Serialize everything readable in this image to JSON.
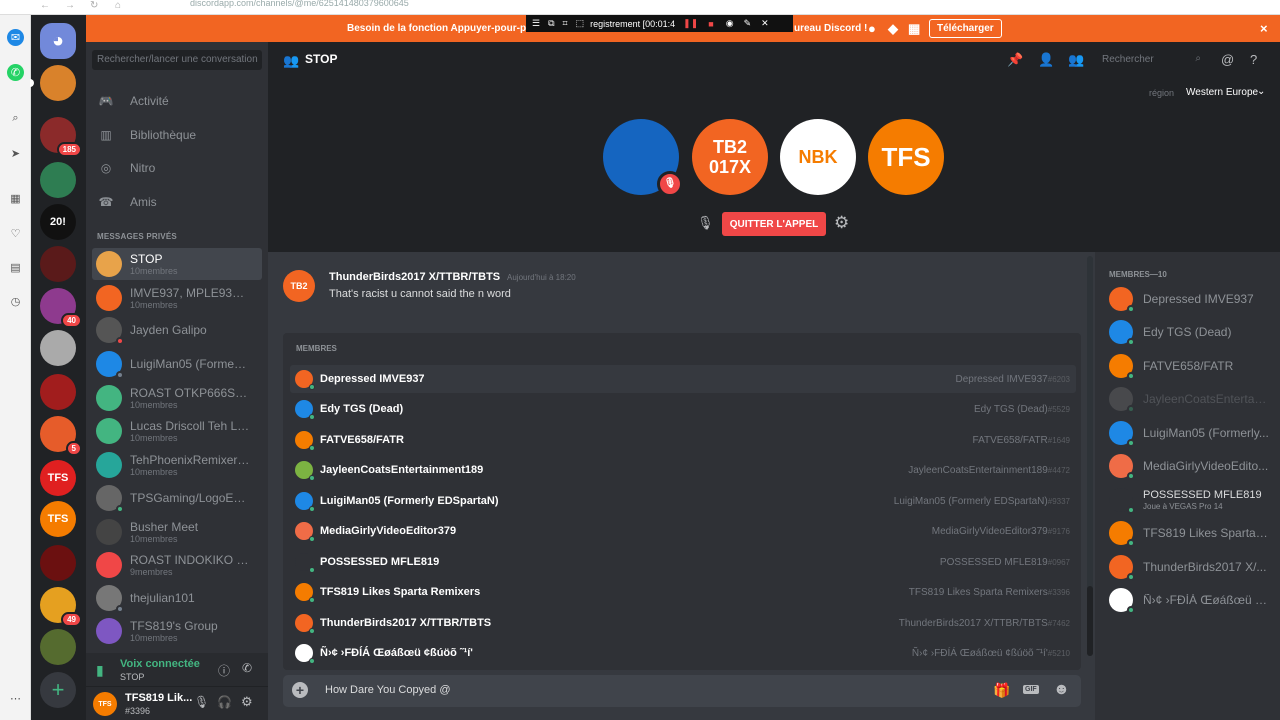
{
  "browser": {
    "url": "discordapp.com/channels/@me/625141480379600645"
  },
  "banner": {
    "text_left": "Besoin de la fonction Appuyer-pour-par",
    "text_right": "ureau Discord !",
    "download": "Télécharger",
    "close": "×"
  },
  "recorder": {
    "label": "registrement [00:01:4"
  },
  "dm_search": {
    "placeholder": "Rechercher/lancer une conversation"
  },
  "nav": [
    {
      "label": "Activité",
      "icon": "gamepad-icon"
    },
    {
      "label": "Bibliothèque",
      "icon": "library-icon"
    },
    {
      "label": "Nitro",
      "icon": "nitro-icon"
    },
    {
      "label": "Amis",
      "icon": "friends-icon"
    }
  ],
  "dm_header": "MESSAGES PRIVÉS",
  "dms": [
    {
      "name": "STOP",
      "sub": "10membres",
      "color": "#e8a34a",
      "sel": true
    },
    {
      "name": "IMVE937, MPLE935, ...",
      "sub": "10membres",
      "color": "#f26522"
    },
    {
      "name": "Jayden Galipo",
      "sub": "",
      "color": "#555"
    },
    {
      "name": "LuigiMan05 (Formerl...",
      "sub": "",
      "color": "#1e88e5"
    },
    {
      "name": "ROAST OTKP666SC ...",
      "sub": "10membres",
      "color": "#43b581"
    },
    {
      "name": "Lucas Driscoll Teh Lu...",
      "sub": "10membres",
      "color": "#43b581"
    },
    {
      "name": "TehPhoenixRemixer9...",
      "sub": "10membres",
      "color": "#26a69a"
    },
    {
      "name": "TPSGaming/LogoEdi...",
      "sub": "",
      "color": "#666"
    },
    {
      "name": "Busher Meet",
      "sub": "10membres",
      "color": "#444"
    },
    {
      "name": "ROAST INDOKIKO F...",
      "sub": "9membres",
      "color": "#f04747"
    },
    {
      "name": "thejulian101",
      "sub": "",
      "color": "#777"
    },
    {
      "name": "TFS819's Group",
      "sub": "10membres",
      "color": "#7e57c2"
    }
  ],
  "voice": {
    "title": "Voix connectée",
    "channel": "STOP"
  },
  "user": {
    "name": "TFS819 Lik...",
    "tag": "#3396",
    "avatar_text": "TFS"
  },
  "guilds": [
    {
      "text": "",
      "color": "#7289da",
      "badge": ""
    },
    {
      "text": "",
      "color": "#d9822b",
      "badge": ""
    },
    {
      "text": "",
      "color": "#8b2a2a",
      "badge": "185"
    },
    {
      "text": "",
      "color": "#2e7d52",
      "badge": ""
    },
    {
      "text": "20!",
      "color": "#111",
      "badge": ""
    },
    {
      "text": "",
      "color": "#5a1a1a",
      "badge": ""
    },
    {
      "text": "",
      "color": "#8e3a8e",
      "badge": "40"
    },
    {
      "text": "",
      "color": "#aaa",
      "badge": ""
    },
    {
      "text": "",
      "color": "#a11d1d",
      "badge": ""
    },
    {
      "text": "",
      "color": "#e65c2a",
      "badge": "5"
    },
    {
      "text": "TFS",
      "color": "#e02020",
      "badge": ""
    },
    {
      "text": "TFS",
      "color": "#f57c00",
      "badge": ""
    },
    {
      "text": "",
      "color": "#6b1010",
      "badge": ""
    },
    {
      "text": "",
      "color": "#e5a020",
      "badge": "49"
    },
    {
      "text": "",
      "color": "#556b2f",
      "badge": ""
    }
  ],
  "channel": {
    "title": "STOP",
    "search_placeholder": "Rechercher"
  },
  "region": {
    "label": "région",
    "value": "Western Europe"
  },
  "call": {
    "participants": [
      {
        "text": "",
        "color": "#1565c0",
        "muted": true
      },
      {
        "text": "TB2\n017X",
        "color": "#f26522",
        "muted": false
      },
      {
        "text": "NBK",
        "color": "#ffffff",
        "muted": false
      },
      {
        "text": "TFS",
        "color": "#f57c00",
        "muted": false
      }
    ],
    "leave": "QUITTER L'APPEL"
  },
  "message": {
    "author": "ThunderBirds2017 X/TTBR/TBTS",
    "time": "Aujourd'hui à 18:20",
    "text": "That's racist u cannot said the n word",
    "avatar_text": "TB2"
  },
  "popup": {
    "title": "MEMBRES",
    "rows": [
      {
        "name": "Depressed IMVE937",
        "tag": "Depressed IMVE937",
        "disc": "#6203",
        "color": "#f26522"
      },
      {
        "name": "Edy TGS (Dead)",
        "tag": "Edy TGS (Dead)",
        "disc": "#5529",
        "color": "#1e88e5"
      },
      {
        "name": "FATVE658/FATR",
        "tag": "FATVE658/FATR",
        "disc": "#1649",
        "color": "#f57c00"
      },
      {
        "name": "JayleenCoatsEntertainment189",
        "tag": "JayleenCoatsEntertainment189",
        "disc": "#4472",
        "color": "#7cb342"
      },
      {
        "name": "LuigiMan05 (Formerly EDSpartaN)",
        "tag": "LuigiMan05 (Formerly EDSpartaN)",
        "disc": "#9337",
        "color": "#1e88e5"
      },
      {
        "name": "MediaGirlyVideoEditor379",
        "tag": "MediaGirlyVideoEditor379",
        "disc": "#9176",
        "color": "#ef6c47"
      },
      {
        "name": "POSSESSED MFLE819",
        "tag": "POSSESSED MFLE819",
        "disc": "#0967",
        "color": "#2f3136"
      },
      {
        "name": "TFS819 Likes Sparta Remixers",
        "tag": "TFS819 Likes Sparta Remixers",
        "disc": "#3396",
        "color": "#f57c00"
      },
      {
        "name": "ThunderBirds2017 X/TTBR/TBTS",
        "tag": "ThunderBirds2017 X/TTBR/TBTS",
        "disc": "#7462",
        "color": "#f26522"
      },
      {
        "name": "Ñ›¢ ›FÐÍÁ Œøáßœü ¢ßúöõ ˜¹í'",
        "tag": "Ñ›¢ ›FÐÍÁ Œøáßœü ¢ßúöõ ˜¹í'",
        "disc": "#5210",
        "color": "#ffffff"
      }
    ]
  },
  "input": {
    "value": "How Dare You Copyed @"
  },
  "members": {
    "header": "MEMBRES—10",
    "list": [
      {
        "name": "Depressed IMVE937",
        "sub": "",
        "color": "#f26522",
        "dim": false
      },
      {
        "name": "Edy TGS (Dead)",
        "sub": "",
        "color": "#1e88e5",
        "dim": false
      },
      {
        "name": "FATVE658/FATR",
        "sub": "",
        "color": "#f57c00",
        "dim": false
      },
      {
        "name": "JayleenCoatsEntertain...",
        "sub": "",
        "color": "#777",
        "dim": true
      },
      {
        "name": "LuigiMan05 (Formerly...",
        "sub": "",
        "color": "#1e88e5",
        "dim": false
      },
      {
        "name": "MediaGirlyVideoEdito...",
        "sub": "",
        "color": "#ef6c47",
        "dim": false
      },
      {
        "name": "POSSESSED MFLE819",
        "sub": "Joue à VEGAS Pro 14",
        "color": "#2f3136",
        "dim": false
      },
      {
        "name": "TFS819 Likes Sparta R...",
        "sub": "",
        "color": "#f57c00",
        "dim": false
      },
      {
        "name": "ThunderBirds2017 X/...",
        "sub": "",
        "color": "#f26522",
        "dim": false
      },
      {
        "name": "Ñ›¢ ›FÐÍÁ Œøáßœü ¢...",
        "sub": "",
        "color": "#ffffff",
        "dim": false
      }
    ]
  }
}
